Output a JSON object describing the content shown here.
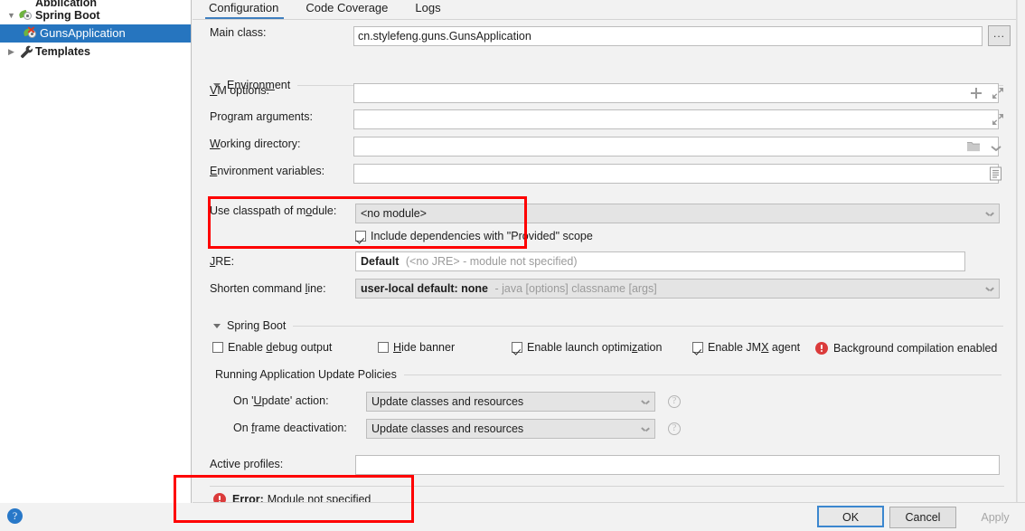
{
  "tree": {
    "items": [
      {
        "label": "Application",
        "icon": "app-icon",
        "level": 1,
        "twisty": "none",
        "clipped": true,
        "selected": false
      },
      {
        "label": "Spring Boot",
        "icon": "spring-boot-icon",
        "level": 1,
        "twisty": "expanded",
        "clipped": false,
        "selected": false
      },
      {
        "label": "GunsApplication",
        "icon": "spring-boot-error-icon",
        "level": 2,
        "twisty": "none",
        "clipped": false,
        "selected": true
      },
      {
        "label": "Templates",
        "icon": "wrench-icon",
        "level": 1,
        "twisty": "collapsed",
        "clipped": false,
        "selected": false
      }
    ]
  },
  "tabs": [
    {
      "label": "Configuration",
      "active": true
    },
    {
      "label": "Code Coverage",
      "active": false
    },
    {
      "label": "Logs",
      "active": false
    }
  ],
  "form": {
    "main_class": {
      "label": "Main class:",
      "value": "cn.stylefeng.guns.GunsApplication",
      "browse_label": "..."
    },
    "environment_section": "Environment",
    "vm_options": {
      "label_pre": "V",
      "label_mnemonic": "",
      "label": "VM options:",
      "value": "",
      "mnemonic": "V"
    },
    "program_arguments": {
      "label": "Program arguments:",
      "value": "",
      "mnemonic": "g"
    },
    "working_directory": {
      "label": "Working directory:",
      "value": "",
      "mnemonic": "W"
    },
    "environment_variables": {
      "label": "Environment variables:",
      "value": "",
      "mnemonic": "E"
    },
    "use_classpath_of_module": {
      "label": "Use classpath of module:",
      "value": "<no module>",
      "mnemonic": "o"
    },
    "include_provided": {
      "label": "Include dependencies with \"Provided\" scope",
      "checked": true
    },
    "jre": {
      "label": "JRE:",
      "value_bold": "Default",
      "value_gray": "(<no JRE> - module not specified)",
      "mnemonic": "J"
    },
    "shorten_command_line": {
      "label": "Shorten command line:",
      "value_bold": "user-local default: none",
      "value_gray": "- java [options] classname [args]",
      "mnemonic": "l"
    },
    "spring_boot_section": "Spring Boot",
    "checkboxes": [
      {
        "label": "Enable debug output",
        "checked": false,
        "mnemonic": "d"
      },
      {
        "label": "Hide banner",
        "checked": false,
        "mnemonic": "H"
      },
      {
        "label": "Enable launch optimization",
        "checked": true,
        "mnemonic": "z"
      },
      {
        "label": "Enable JMX agent",
        "checked": true,
        "mnemonic": "X"
      }
    ],
    "background_compilation": "Background compilation enabled",
    "update_policies_section": "Running Application Update Policies",
    "on_update_action": {
      "label": "On 'Update' action:",
      "value": "Update classes and resources",
      "mnemonic": "U",
      "help": "?"
    },
    "on_frame_deactivation": {
      "label": "On frame deactivation:",
      "value": "Update classes and resources",
      "mnemonic": "f",
      "help": "?"
    },
    "active_profiles": {
      "label": "Active profiles:",
      "value": ""
    }
  },
  "error": {
    "prefix": "Error:",
    "message": "Module not specified"
  },
  "bottom": {
    "help": "?",
    "ok": "OK",
    "cancel": "Cancel",
    "apply": "Apply"
  },
  "colors": {
    "selection_blue": "#2675bf",
    "annotation_red": "#fe0000",
    "error_red": "#db3b3b",
    "tab_accent": "#3f7fbf",
    "help_blue": "#2878c8"
  }
}
